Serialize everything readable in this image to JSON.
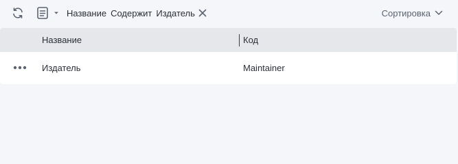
{
  "toolbar": {
    "refresh_icon": "refresh-icon",
    "filter_icon": "filter-list-icon",
    "filter_chip": {
      "field": "Название",
      "operator": "Содержит",
      "value": "Издатель"
    },
    "sort_label": "Сортировка"
  },
  "table": {
    "columns": [
      "Название",
      "Код"
    ],
    "rows": [
      {
        "name": "Издатель",
        "code": "Maintainer"
      }
    ]
  },
  "colors": {
    "background": "#f5f6f9",
    "header_bg": "#e6e7ea",
    "row_bg": "#ffffff",
    "icon": "#5b6271"
  }
}
